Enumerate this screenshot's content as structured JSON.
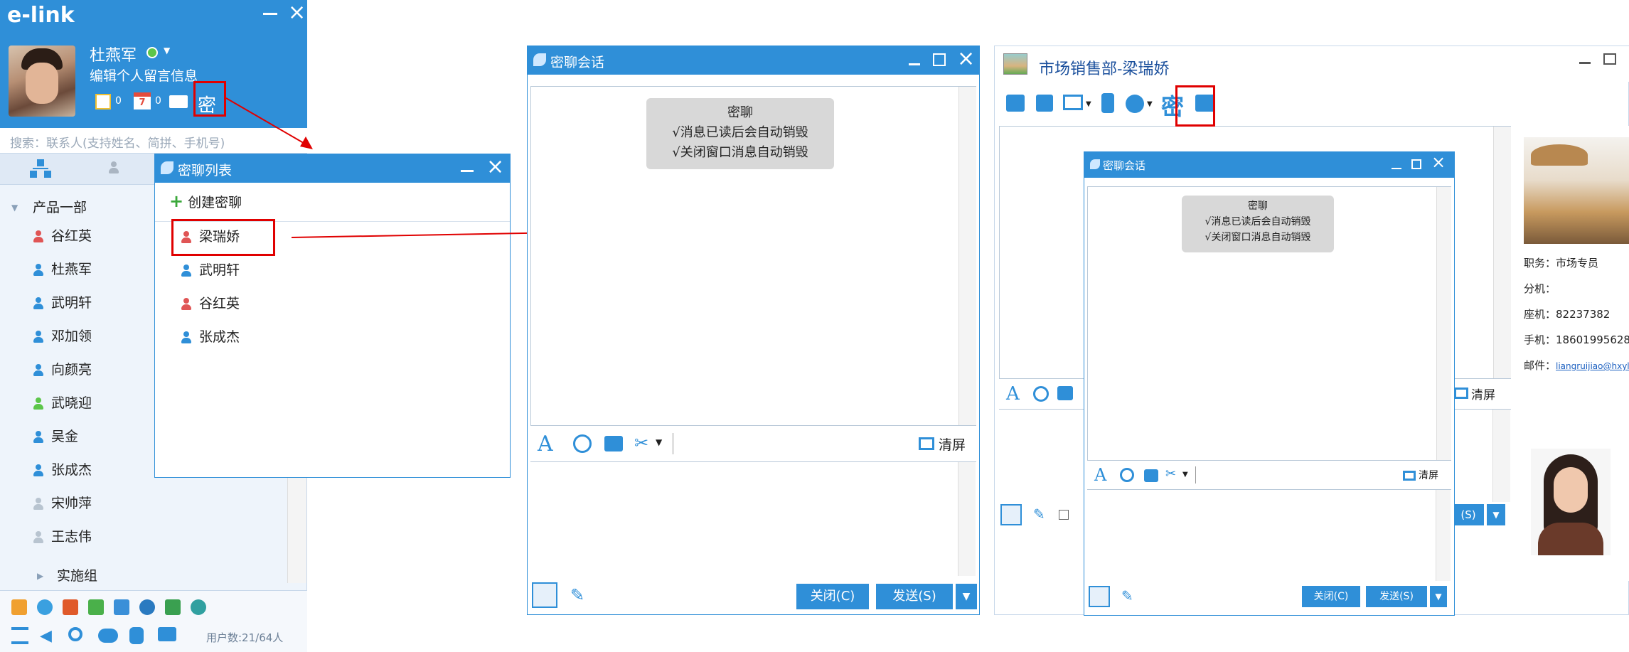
{
  "left_panel": {
    "logo": "e-link",
    "user_name": "杜燕军",
    "signature": "编辑个人留言信息",
    "note_count": "0",
    "calendar_count": "0",
    "secret_label": "密",
    "search_placeholder": "搜索：联系人(支持姓名、简拼、手机号)",
    "group_label": "产品一部",
    "contacts": [
      "谷红英",
      "杜燕军",
      "武明轩",
      "邓加领",
      "向颜亮",
      "武晓迎",
      "吴金",
      "张成杰",
      "宋帅萍",
      "王志伟"
    ],
    "subgroup_label": "实施组",
    "user_count": "用户数:21/64人",
    "colors": {
      "header": "#2f8fd8",
      "background": "#eef4fb"
    }
  },
  "secret_list": {
    "title": "密聊列表",
    "create_label": "创建密聊",
    "items": [
      "梁瑞娇",
      "武明轩",
      "谷红英",
      "张成杰"
    ]
  },
  "chat_window_1": {
    "title": "密聊会话",
    "bubble": {
      "title": "密聊",
      "line1": "√消息已读后会自动销毁",
      "line2": "√关闭窗口消息自动销毁"
    },
    "clear_label": "清屏",
    "close_label": "关闭(C)",
    "send_label": "发送(S)"
  },
  "main_chat": {
    "title": "市场销售部-梁瑞娇",
    "secret_label": "密",
    "profile": {
      "position": "职务：市场专员",
      "ext": "分机：",
      "phone": "座机：82237382",
      "mobile": "手机：18601995628",
      "email_label": "邮件：",
      "email": "liangruijiao@hxyl..."
    },
    "clear_label": "清屏",
    "send_label": "(S)"
  },
  "chat_window_2": {
    "title": "密聊会话",
    "bubble": {
      "title": "密聊",
      "line1": "√消息已读后会自动销毁",
      "line2": "√关闭窗口消息自动销毁"
    },
    "clear_label": "清屏",
    "close_label": "关闭(C)",
    "send_label": "发送(S)"
  }
}
